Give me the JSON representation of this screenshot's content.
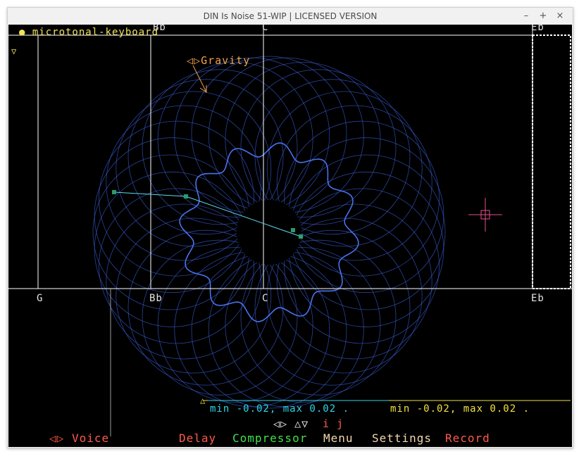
{
  "window": {
    "title": "DIN Is Noise 51-WIP | LICENSED VERSION",
    "controls": [
      "–",
      "+",
      "×"
    ]
  },
  "keyboard": {
    "label": "microtonal-keyboard",
    "notes_top": [
      "Bb",
      "C",
      "Eb"
    ],
    "notes_bottom": [
      "G",
      "Bb",
      "C",
      "Eb"
    ]
  },
  "gravity": {
    "label": "Gravity",
    "arrow_glyph": "◁▷"
  },
  "readouts": {
    "cyan": "min -0.02, max 0.02 .",
    "yellow": "min -0.02, max 0.02 ."
  },
  "nav": {
    "arrows": "◁▷ △▽",
    "keys": "i j",
    "up_marker": "△",
    "top_marker": "▽"
  },
  "bottom_menu": {
    "voice_arrows": "◁▷",
    "voice": "Voice",
    "delay": "Delay",
    "compressor": "Compressor",
    "menu": "Menu",
    "settings": "Settings",
    "record": "Record"
  },
  "colors": {
    "background": "#000000",
    "spiro": "#3a5fd8",
    "keyboard_label": "#f2e35a",
    "gravity": "#f0a24a",
    "cyan": "#2fd6e8",
    "yellow": "#f2e040",
    "voice": "#ff5a4a",
    "delay": "#ff5a4a",
    "compressor": "#3ee04a",
    "menu": "#f4d8b0",
    "settings": "#f4d8b0",
    "record": "#ff5a4a",
    "crosshair": "#e8508a"
  }
}
